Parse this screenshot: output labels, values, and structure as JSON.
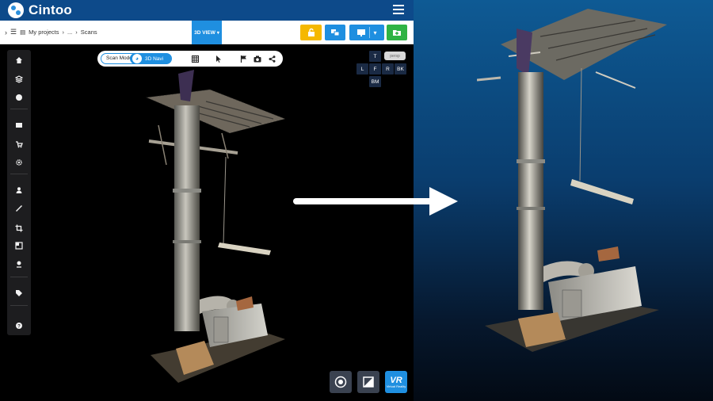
{
  "app": {
    "name": "Cintoo",
    "icons": {
      "logo": "cintoo-logo",
      "menu": "hamburger-icon"
    }
  },
  "toolbar": {
    "breadcrumb": [
      "My projects",
      "...",
      "Scans"
    ],
    "view_mode": "3D VIEW",
    "buttons": [
      "lock-icon",
      "compare-icon",
      "monitor-icon",
      "add-folder-icon"
    ]
  },
  "sidebar": {
    "items": [
      "home-icon",
      "layers-icon",
      "sphere-icon",
      "screen-icon",
      "cart-icon",
      "settings-icon",
      "person-icon",
      "ruler-icon",
      "crop-icon",
      "split-icon",
      "poi-icon",
      "tag-icon",
      "help-icon"
    ]
  },
  "nav_pill": {
    "scan_mode_label": "Scan Mode",
    "nav_3d_label": "3D Navi",
    "tools": [
      "grid-icon",
      "pointer-icon",
      "flag-icon",
      "camera-icon",
      "share-icon"
    ]
  },
  "view_cube": {
    "top": "T",
    "left": "L",
    "front": "F",
    "right": "R",
    "back": "BK",
    "bottom": "BM",
    "perspective": "persp"
  },
  "bottom_buttons": {
    "vr_label": "VR",
    "vr_caption": "Virtual Reality"
  },
  "colors": {
    "brand_blue": "#0d4a8a",
    "accent_blue": "#1f8fe0",
    "warning_yellow": "#f5b800",
    "success_green": "#2fb344"
  }
}
